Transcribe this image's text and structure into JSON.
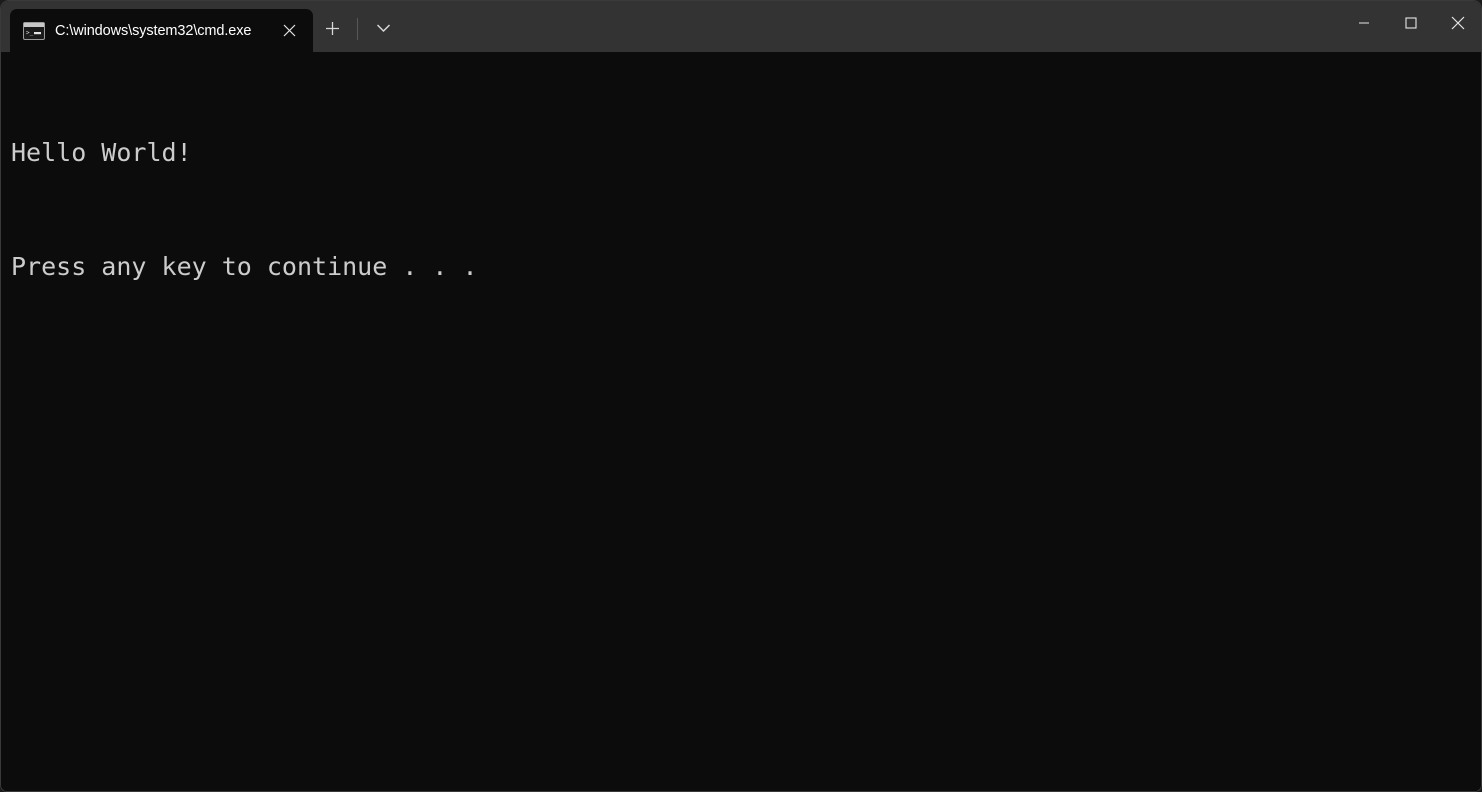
{
  "window": {
    "background": "#0c0c0c",
    "titlebar_background": "#333333",
    "border_color": "#3a3a3a"
  },
  "titlebar": {
    "tabs": [
      {
        "title": "C:\\windows\\system32\\cmd.exe",
        "icon": "cmd-console-icon",
        "close_label": "×",
        "active": true
      }
    ],
    "new_tab_label": "+",
    "dropdown_label": "ˇ",
    "caption": {
      "minimize_label": "—",
      "maximize_label": "□",
      "close_label": "×"
    }
  },
  "terminal": {
    "foreground": "#cccccc",
    "background": "#0c0c0c",
    "lines": [
      "Hello World!",
      "Press any key to continue . . ."
    ]
  }
}
